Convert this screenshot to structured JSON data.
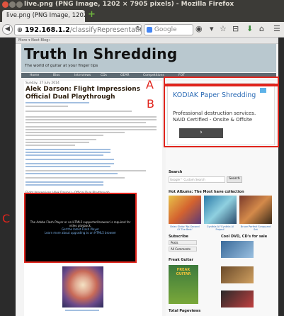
{
  "window": {
    "title": "live.png (PNG Image, 1202 × 7905 pixels) - Mozilla Firefox",
    "close_color": "#e0543f",
    "min_color": "#807d74",
    "max_color": "#807d74"
  },
  "tabs": [
    {
      "label": "live.png (PNG Image, 1202 ..."
    }
  ],
  "navbar": {
    "url_host": "192.168.1.2",
    "url_path": "/classifyRepresentations/headers ▾",
    "search_placeholder": "Google",
    "icons": [
      "back-icon",
      "reload-icon",
      "search-engine-icon",
      "go-icon",
      "bookmark-star-icon",
      "bookmarks-menu-icon",
      "download-icon",
      "home-icon",
      "menu-icon"
    ]
  },
  "blogger_bar": {
    "text": "More ▾   Next Blog»"
  },
  "blog": {
    "title": "Truth In Shredding",
    "tagline": "The world of guitar at your finger tips",
    "menu": [
      "Home",
      "Bios",
      "Interviews",
      "CDs",
      "GEAR",
      "Competitions",
      "FOT"
    ]
  },
  "post": {
    "date": "Sunday, 27 July 2014",
    "title": "Alek Darson: Flight Impressions Official Dual Playthrough",
    "video_title": "Flight Impressions (Alek Darson) - Official Dual Playthrough",
    "video_msg_1": "The Adobe Flash Player or an HTML5 supported browser is required for video playback.",
    "video_msg_2": "Get the latest Flash Player",
    "video_msg_3": "Learn more about upgrading to an HTML5 browser"
  },
  "ad": {
    "title": "KODIAK Paper Shredding",
    "body": "Professional destruction services. NAID Certified - Onsite & Offsite",
    "button": "›"
  },
  "sidebar": {
    "search_heading": "Search",
    "search_placeholder": "Google™ Custom Search",
    "search_button": "Search",
    "albums_heading": "Hot Albums: The Most have collection",
    "album_caps": [
      "Brian Glebz 'No-Second Of The Best'",
      "Cynthia Al 'Cynthia Al Project'",
      "Bruce Perfect Scrapyard Set"
    ],
    "subscribe_heading": "Subscribe",
    "subscribe_posts": "Posts",
    "subscribe_comments": "All Comments",
    "cool_dvd_heading": "Cool DVD, CD's for sale",
    "freak_heading": "Freak Guitar",
    "freak_poster": "FREAK GUITAR",
    "total_heading": "Total Pageviews"
  },
  "annotations": {
    "label_a": "A",
    "label_b": "B",
    "label_c": "C",
    "box_color": "#e0241c"
  }
}
